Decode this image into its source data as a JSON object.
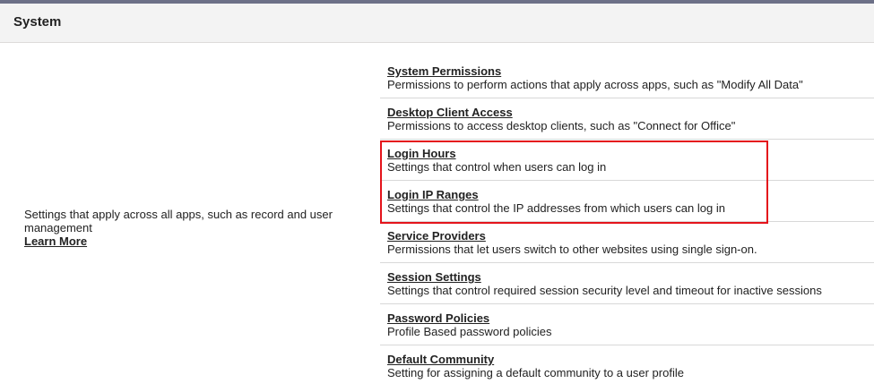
{
  "section": {
    "title": "System",
    "description": "Settings that apply across all apps, such as record and user management",
    "learn_more": "Learn More"
  },
  "items": [
    {
      "title": "System Permissions",
      "description": "Permissions to perform actions that apply across apps, such as \"Modify All Data\""
    },
    {
      "title": "Desktop Client Access",
      "description": "Permissions to access desktop clients, such as \"Connect for Office\""
    },
    {
      "title": "Login Hours",
      "description": "Settings that control when users can log in"
    },
    {
      "title": "Login IP Ranges",
      "description": "Settings that control the IP addresses from which users can log in"
    },
    {
      "title": "Service Providers",
      "description": "Permissions that let users switch to other websites using single sign-on."
    },
    {
      "title": "Session Settings",
      "description": "Settings that control required session security level and timeout for inactive sessions"
    },
    {
      "title": "Password Policies",
      "description": "Profile Based password policies"
    },
    {
      "title": "Default Community",
      "description": "Setting for assigning a default community to a user profile"
    }
  ],
  "colors": {
    "highlight": "#e4141b",
    "header_bg": "#f3f3f3",
    "top_strip": "#6c7087"
  }
}
